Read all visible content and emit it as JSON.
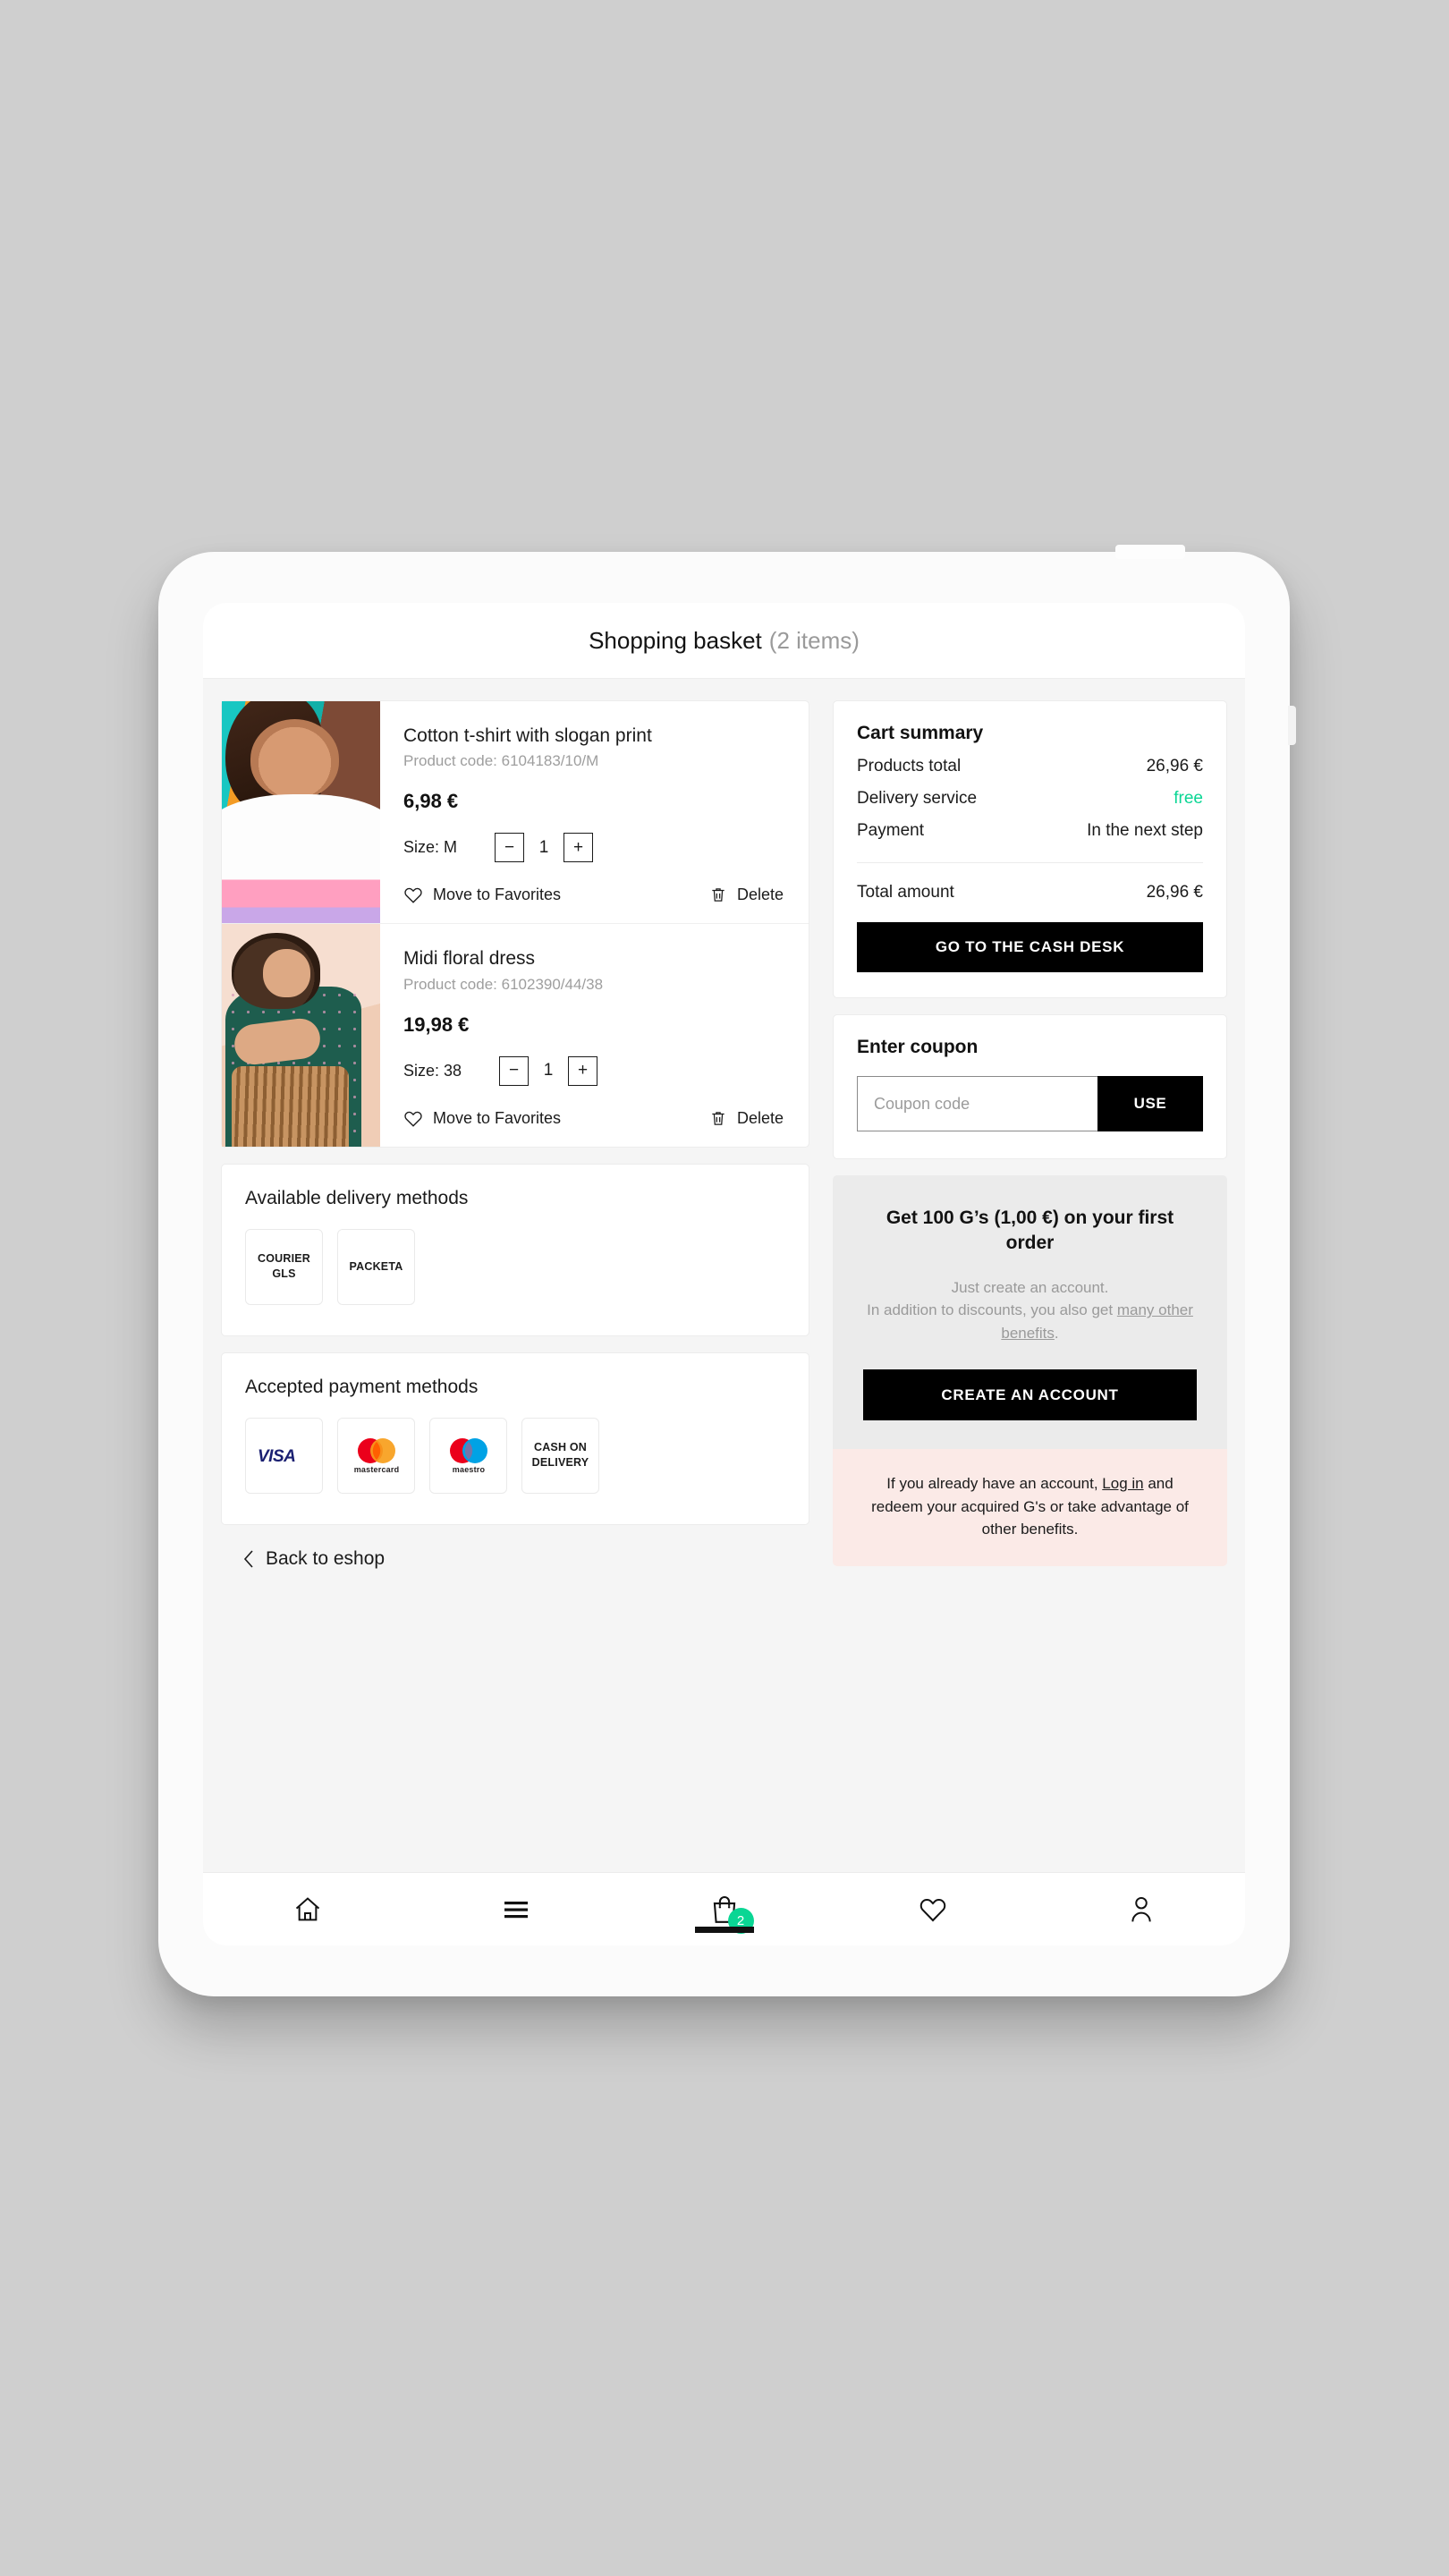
{
  "header": {
    "title": "Shopping basket",
    "count": "(2 items)"
  },
  "products": [
    {
      "name": "Cotton t-shirt with slogan print",
      "code": "Product code: 6104183/10/M",
      "price": "6,98 €",
      "size_label": "Size: M",
      "minus": "−",
      "plus": "+",
      "qty": "1",
      "favorites_label": "Move to Favorites",
      "delete_label": "Delete"
    },
    {
      "name": "Midi floral dress",
      "code": "Product code: 6102390/44/38",
      "price": "19,98 €",
      "size_label": "Size: 38",
      "minus": "−",
      "plus": "+",
      "qty": "1",
      "favorites_label": "Move to Favorites",
      "delete_label": "Delete"
    }
  ],
  "delivery": {
    "title": "Available delivery methods",
    "methods": [
      "COURIER GLS",
      "PACKETA"
    ]
  },
  "payment": {
    "title": "Accepted payment methods",
    "methods": [
      {
        "kind": "visa",
        "label": "VISA"
      },
      {
        "kind": "mastercard",
        "label": "mastercard"
      },
      {
        "kind": "maestro",
        "label": "maestro"
      },
      {
        "kind": "text",
        "label": "CASH ON DELIVERY"
      }
    ]
  },
  "back": {
    "label": "Back to eshop",
    "icon": "chevron-left-icon"
  },
  "summary": {
    "title": "Cart summary",
    "rows": [
      {
        "label": "Products total",
        "value": "26,96 €",
        "accent": false
      },
      {
        "label": "Delivery service",
        "value": "free",
        "accent": true
      },
      {
        "label": "Payment",
        "value": "In the next step",
        "accent": false
      }
    ],
    "total_label": "Total amount",
    "total_value": "26,96 €",
    "cta": "GO TO THE CASH DESK"
  },
  "coupon": {
    "title": "Enter coupon",
    "placeholder": "Coupon code",
    "value": "",
    "button": "USE"
  },
  "promo": {
    "title": "Get 100 G’s (1,00 €) on your first order",
    "sub_line1": "Just create an account.",
    "sub_line2_pre": "In addition to discounts, you also get ",
    "sub_line2_link": "many other benefits",
    "sub_line2_post": ".",
    "button": "CREATE AN ACCOUNT",
    "login_pre": "If you already have an account, ",
    "login_link": "Log in",
    "login_post": " and redeem your acquired G's or take advantage of other benefits."
  },
  "bottom_nav": {
    "items": [
      {
        "icon": "home-icon",
        "active": false
      },
      {
        "icon": "menu-icon",
        "active": false
      },
      {
        "icon": "shopping-bag-icon",
        "active": true,
        "badge": "2"
      },
      {
        "icon": "heart-icon",
        "active": false
      },
      {
        "icon": "user-icon",
        "active": false
      }
    ]
  },
  "colors": {
    "accent_green": "#0ad694",
    "cta_black": "#000000",
    "promo_bg": "#ebebeb",
    "login_bg": "#fbeae7"
  }
}
